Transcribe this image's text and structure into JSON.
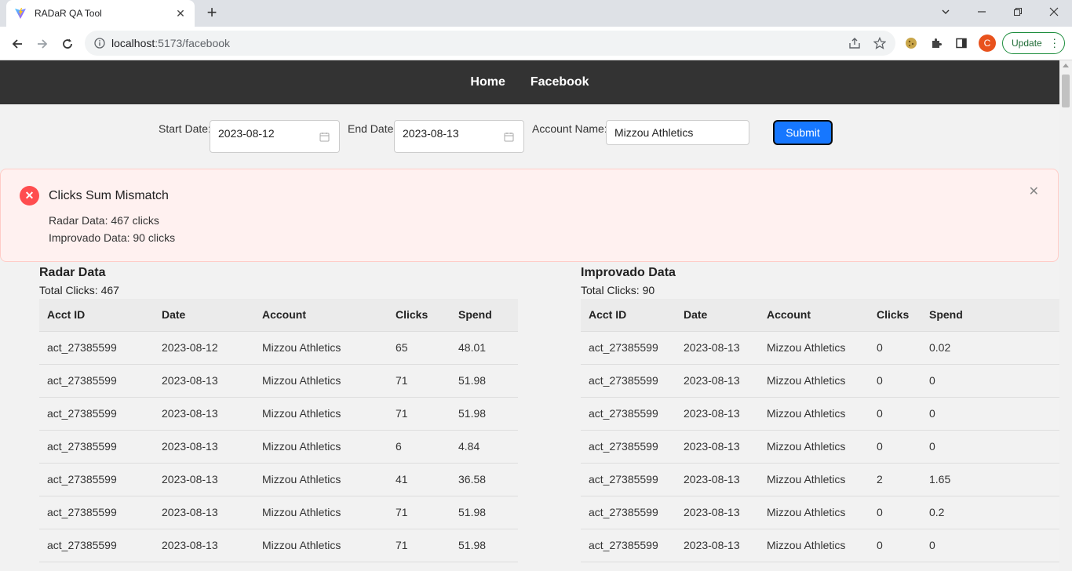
{
  "browser": {
    "tab_title": "RADaR QA Tool",
    "url_host": "localhost",
    "url_rest": ":5173/facebook",
    "profile_initial": "C",
    "update_label": "Update"
  },
  "nav": {
    "home": "Home",
    "facebook": "Facebook"
  },
  "filters": {
    "start_label": "Start Date:",
    "start_value": "2023-08-12",
    "end_label": "End Date:",
    "end_value": "2023-08-13",
    "account_label": "Account Name:",
    "account_value": "Mizzou Athletics",
    "submit_label": "Submit"
  },
  "alert": {
    "title": "Clicks Sum Mismatch",
    "radar_line": "Radar Data: 467 clicks",
    "improvado_line": "Improvado Data: 90 clicks"
  },
  "radar": {
    "title": "Radar Data",
    "total": "Total Clicks: 467",
    "headers": [
      "Acct ID",
      "Date",
      "Account",
      "Clicks",
      "Spend"
    ],
    "rows": [
      [
        "act_27385599",
        "2023-08-12",
        "Mizzou Athletics",
        "65",
        "48.01"
      ],
      [
        "act_27385599",
        "2023-08-13",
        "Mizzou Athletics",
        "71",
        "51.98"
      ],
      [
        "act_27385599",
        "2023-08-13",
        "Mizzou Athletics",
        "71",
        "51.98"
      ],
      [
        "act_27385599",
        "2023-08-13",
        "Mizzou Athletics",
        "6",
        "4.84"
      ],
      [
        "act_27385599",
        "2023-08-13",
        "Mizzou Athletics",
        "41",
        "36.58"
      ],
      [
        "act_27385599",
        "2023-08-13",
        "Mizzou Athletics",
        "71",
        "51.98"
      ],
      [
        "act_27385599",
        "2023-08-13",
        "Mizzou Athletics",
        "71",
        "51.98"
      ]
    ]
  },
  "improvado": {
    "title": "Improvado Data",
    "total": "Total Clicks: 90",
    "headers": [
      "Acct ID",
      "Date",
      "Account",
      "Clicks",
      "Spend"
    ],
    "rows": [
      [
        "act_27385599",
        "2023-08-13",
        "Mizzou Athletics",
        "0",
        "0.02"
      ],
      [
        "act_27385599",
        "2023-08-13",
        "Mizzou Athletics",
        "0",
        "0"
      ],
      [
        "act_27385599",
        "2023-08-13",
        "Mizzou Athletics",
        "0",
        "0"
      ],
      [
        "act_27385599",
        "2023-08-13",
        "Mizzou Athletics",
        "0",
        "0"
      ],
      [
        "act_27385599",
        "2023-08-13",
        "Mizzou Athletics",
        "2",
        "1.65"
      ],
      [
        "act_27385599",
        "2023-08-13",
        "Mizzou Athletics",
        "0",
        "0.2"
      ],
      [
        "act_27385599",
        "2023-08-13",
        "Mizzou Athletics",
        "0",
        "0"
      ]
    ]
  }
}
